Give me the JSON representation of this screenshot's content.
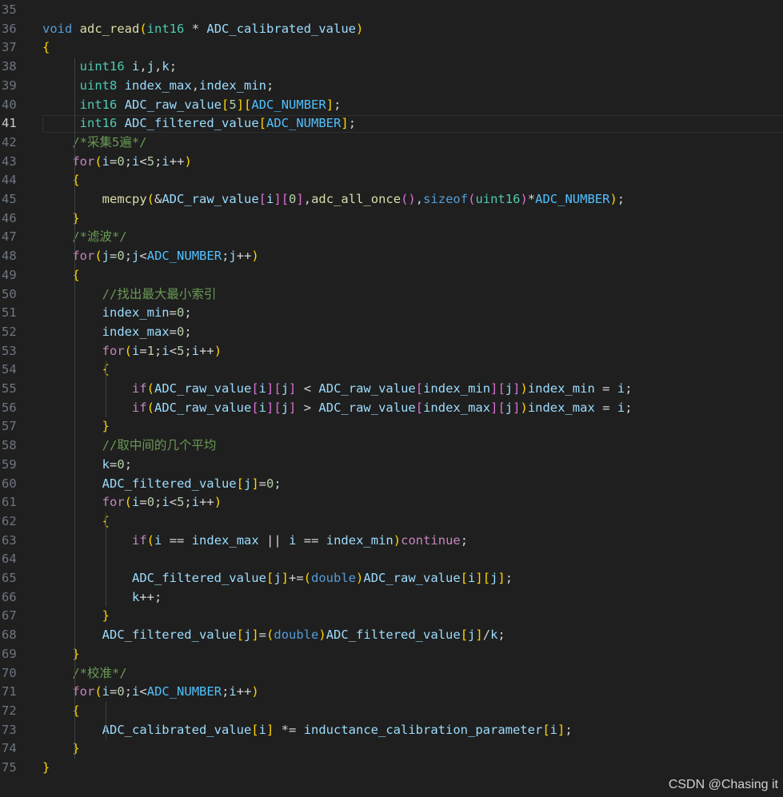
{
  "editor": {
    "lines": [
      {
        "n": "35",
        "t": ""
      },
      {
        "n": "36",
        "t": "void adc_read(int16 * ADC_calibrated_value)"
      },
      {
        "n": "37",
        "t": "{"
      },
      {
        "n": "38",
        "t": "     uint16 i,j,k;"
      },
      {
        "n": "39",
        "t": "     uint8 index_max,index_min;"
      },
      {
        "n": "40",
        "t": "     int16 ADC_raw_value[5][ADC_NUMBER];"
      },
      {
        "n": "41",
        "t": "     int16 ADC_filtered_value[ADC_NUMBER];"
      },
      {
        "n": "42",
        "t": "    /*采集5遍*/"
      },
      {
        "n": "43",
        "t": "    for(i=0;i<5;i++)"
      },
      {
        "n": "44",
        "t": "    {"
      },
      {
        "n": "45",
        "t": "        memcpy(&ADC_raw_value[i][0],adc_all_once(),sizeof(uint16)*ADC_NUMBER);"
      },
      {
        "n": "46",
        "t": "    }"
      },
      {
        "n": "47",
        "t": "    /*滤波*/"
      },
      {
        "n": "48",
        "t": "    for(j=0;j<ADC_NUMBER;j++)"
      },
      {
        "n": "49",
        "t": "    {"
      },
      {
        "n": "50",
        "t": "        //找出最大最小索引"
      },
      {
        "n": "51",
        "t": "        index_min=0;"
      },
      {
        "n": "52",
        "t": "        index_max=0;"
      },
      {
        "n": "53",
        "t": "        for(i=1;i<5;i++)"
      },
      {
        "n": "54",
        "t": "        {"
      },
      {
        "n": "55",
        "t": "            if(ADC_raw_value[i][j] < ADC_raw_value[index_min][j])index_min = i;"
      },
      {
        "n": "56",
        "t": "            if(ADC_raw_value[i][j] > ADC_raw_value[index_max][j])index_max = i;"
      },
      {
        "n": "57",
        "t": "        }"
      },
      {
        "n": "58",
        "t": "        //取中间的几个平均"
      },
      {
        "n": "59",
        "t": "        k=0;"
      },
      {
        "n": "60",
        "t": "        ADC_filtered_value[j]=0;"
      },
      {
        "n": "61",
        "t": "        for(i=0;i<5;i++)"
      },
      {
        "n": "62",
        "t": "        {"
      },
      {
        "n": "63",
        "t": "            if(i == index_max || i == index_min)continue;"
      },
      {
        "n": "64",
        "t": ""
      },
      {
        "n": "65",
        "t": "            ADC_filtered_value[j]+=(double)ADC_raw_value[i][j];"
      },
      {
        "n": "66",
        "t": "            k++;"
      },
      {
        "n": "67",
        "t": "        }"
      },
      {
        "n": "68",
        "t": "        ADC_filtered_value[j]=(double)ADC_filtered_value[j]/k;"
      },
      {
        "n": "69",
        "t": "    }"
      },
      {
        "n": "70",
        "t": "    /*校准*/"
      },
      {
        "n": "71",
        "t": "    for(i=0;i<ADC_NUMBER;i++)"
      },
      {
        "n": "72",
        "t": "    {"
      },
      {
        "n": "73",
        "t": "        ADC_calibrated_value[i] *= inductance_calibration_parameter[i];"
      },
      {
        "n": "74",
        "t": "    }"
      },
      {
        "n": "75",
        "t": "}"
      }
    ],
    "current_line": "41"
  },
  "watermark": "CSDN @Chasing  it",
  "colors": {
    "background": "#1f1f1f",
    "keyword": "#569cd6",
    "control": "#c586c0",
    "function": "#dcdcaa",
    "type": "#4ec9b0",
    "variable": "#9cdcfe",
    "number": "#b5cea8",
    "comment": "#6a9955",
    "macro": "#4fc1ff"
  }
}
